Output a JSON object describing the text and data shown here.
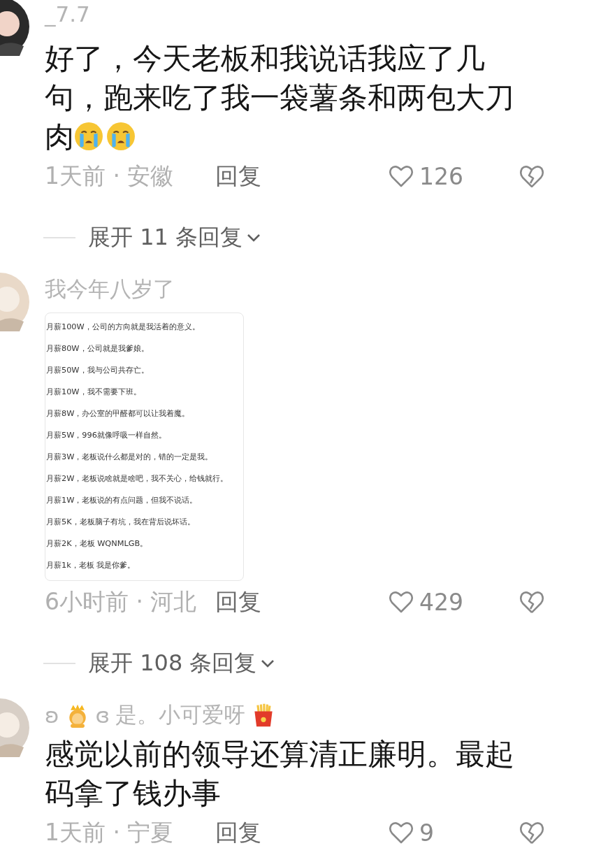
{
  "comments": [
    {
      "name_parts": [
        {
          "kind": "text",
          "text": "_7.7"
        }
      ],
      "body_parts": [
        {
          "kind": "text",
          "text": "好了，今天老板和我说话我应了几句，跑来吃了我一袋薯条和两包大刀"
        },
        {
          "kind": "text",
          "text": "肉"
        },
        {
          "kind": "crying"
        },
        {
          "kind": "crying"
        }
      ],
      "time_location": "1天前 · 安徽",
      "reply": "回复",
      "likes": "126",
      "expand": "展开 11 条回复"
    },
    {
      "name_parts": [
        {
          "kind": "text",
          "text": "我今年八岁了"
        }
      ],
      "image_lines": [
        "月薪100W，公司的方向就是我活着的意义。",
        "月薪80W，公司就是我爹娘。",
        "月薪50W，我与公司共存亡。",
        "月薪10W，我不需要下班。",
        "月薪8W，办公室的甲醛都可以让我着魔。",
        "月薪5W，996就像呼吸一样自然。",
        "月薪3W，老板说什么都是对的，错的一定是我。",
        "月薪2W，老板说啥就是啥吧，我不关心，给钱就行。",
        "月薪1W，老板说的有点问题，但我不说话。",
        "月薪5K，老板脑子有坑，我在背后说坏话。",
        "月薪2K，老板 WQNMLGB。",
        "月薪1k，老板 我是你爹。"
      ],
      "time_location": "6小时前 · 河北",
      "reply": "回复",
      "likes": "429",
      "expand": "展开 108 条回复"
    },
    {
      "name_parts": [
        {
          "kind": "text",
          "text": "ʚ"
        },
        {
          "kind": "princess"
        },
        {
          "kind": "text",
          "text": "ɞ"
        },
        {
          "kind": "text",
          "text": "是。小可爱呀"
        },
        {
          "kind": "fries"
        }
      ],
      "body_parts": [
        {
          "kind": "text",
          "text": "感觉以前的领导还算清正廉明。最起码拿了钱办事"
        }
      ],
      "time_location": "1天前 · 宁夏",
      "reply": "回复",
      "likes": "9"
    }
  ]
}
